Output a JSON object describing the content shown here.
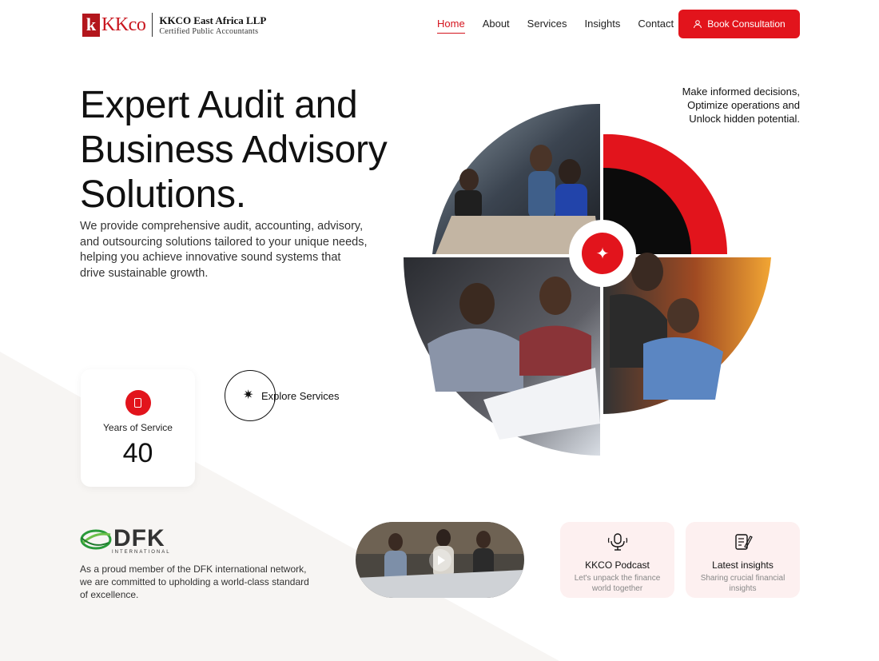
{
  "header": {
    "logo_mark": "k",
    "logo_word": "KKco",
    "company_name": "KKCO East Africa LLP",
    "company_tagline": "Certified Public Accountants",
    "nav": [
      "Home",
      "About",
      "Services",
      "Insights",
      "Contact"
    ],
    "active_nav": "Home",
    "cta_label": "Book Consultation"
  },
  "hero": {
    "title": "Expert Audit and Business Advisory Solutions.",
    "description": "We provide comprehensive audit, accounting, advisory, and outsourcing solutions tailored to your unique needs, helping you achieve innovative sound systems that drive sustainable growth.",
    "tagline_lines": [
      "Make informed decisions,",
      "Optimize operations and",
      "Unlock hidden potential."
    ]
  },
  "stats": {
    "label": "Years of Service",
    "value": "40"
  },
  "explore_label": "Explore Services",
  "dfk": {
    "logo_text": "DFK",
    "logo_subtext": "INTERNATIONAL",
    "description": "As a proud member of the DFK international network, we are committed to upholding a world-class standard of excellence."
  },
  "cards": [
    {
      "title": "KKCO Podcast",
      "subtitle": "Let's unpack the finance world together",
      "icon": "microphone-icon"
    },
    {
      "title": "Latest insights",
      "subtitle": "Sharing crucial financial insights",
      "icon": "document-pen-icon"
    }
  ],
  "colors": {
    "accent": "#e2141c",
    "card_bg": "#fdf0f0"
  }
}
